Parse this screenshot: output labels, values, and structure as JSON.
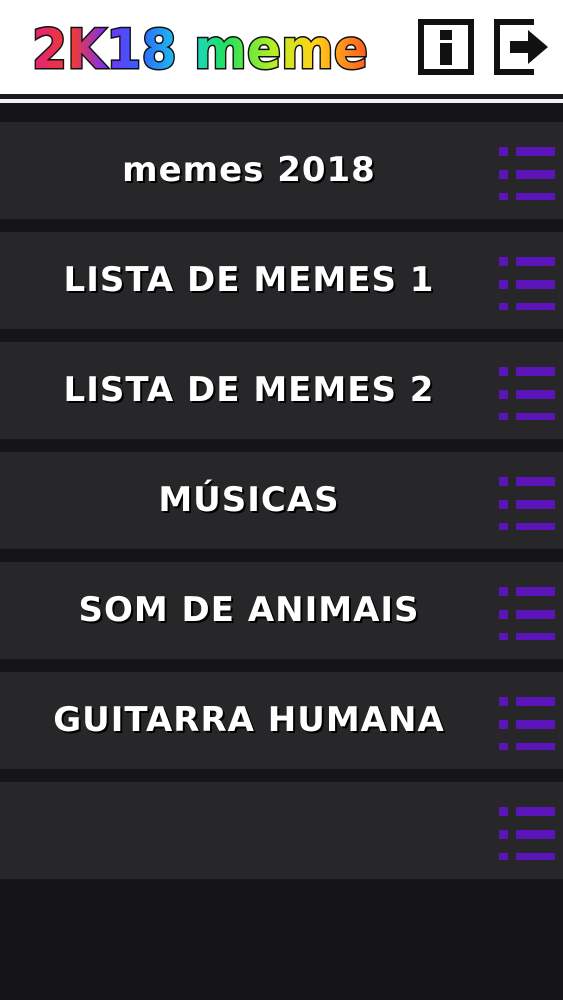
{
  "header": {
    "logo_text": "2K18 meme",
    "info_icon": "info-icon",
    "exit_icon": "exit-icon"
  },
  "colors": {
    "header_bg": "#ffffff",
    "screen_bg": "#151517",
    "item_bg": "#272729",
    "item_text": "#ffffff",
    "list_icon": "#5b14b8"
  },
  "menu": {
    "items": [
      {
        "label": "memes 2018",
        "icon": "list-icon"
      },
      {
        "label": "LISTA DE MEMES 1",
        "icon": "list-icon"
      },
      {
        "label": "LISTA DE MEMES 2",
        "icon": "list-icon"
      },
      {
        "label": "MÚSICAS",
        "icon": "list-icon"
      },
      {
        "label": "SOM DE ANIMAIS",
        "icon": "list-icon"
      },
      {
        "label": "GUITARRA HUMANA",
        "icon": "list-icon"
      },
      {
        "label": "",
        "icon": "list-icon"
      }
    ]
  }
}
